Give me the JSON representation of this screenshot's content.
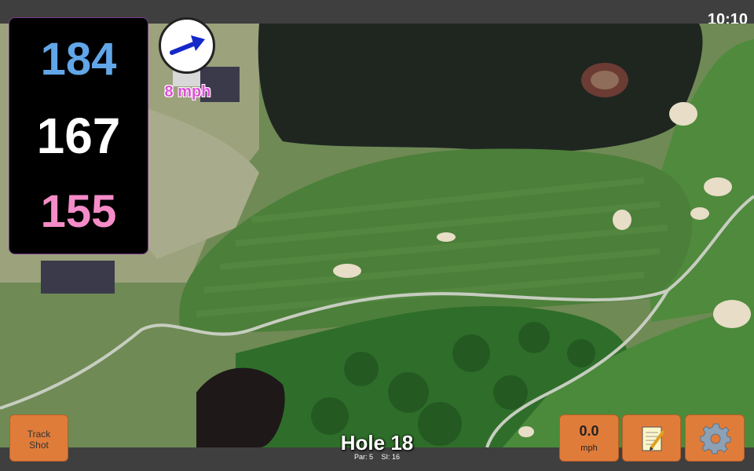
{
  "status_bar": {
    "time": "10:10"
  },
  "distances": {
    "back": "184",
    "middle": "167",
    "front": "155"
  },
  "wind": {
    "speed_label": "8 mph",
    "direction_icon": "arrow-icon"
  },
  "buttons": {
    "track_shot_line1": "Track",
    "track_shot_line2": "Shot",
    "wind_value": "0.0",
    "wind_unit": "mph",
    "notes_icon": "notepad-icon",
    "settings_icon": "gear-icon"
  },
  "hole": {
    "title": "Hole 18",
    "par_label": "Par: 5",
    "si_label": "SI: 16"
  },
  "colors": {
    "back_distance": "#61a6e8",
    "middle_distance": "#ffffff",
    "front_distance": "#f58cc8",
    "button_orange": "#e07c3a",
    "wind_label": "#e050d8"
  }
}
